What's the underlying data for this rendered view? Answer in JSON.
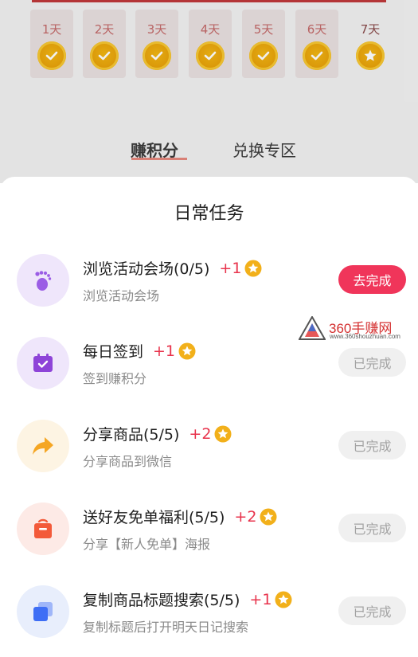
{
  "checkin": {
    "days": [
      {
        "label": "1天",
        "state": "checked"
      },
      {
        "label": "2天",
        "state": "checked"
      },
      {
        "label": "3天",
        "state": "checked"
      },
      {
        "label": "4天",
        "state": "checked"
      },
      {
        "label": "5天",
        "state": "checked"
      },
      {
        "label": "6天",
        "state": "checked"
      },
      {
        "label": "7天",
        "state": "star"
      }
    ]
  },
  "tabs": {
    "earn": "赚积分",
    "exchange": "兑换专区"
  },
  "sheet": {
    "title": "日常任务",
    "tasks": [
      {
        "title": "浏览活动会场(0/5)",
        "plus": "+1",
        "subtitle": "浏览活动会场",
        "button": "去完成",
        "icon": "footprint-icon",
        "icon_bg": "#efe6fb",
        "icon_color": "#9b5de5"
      },
      {
        "title": "每日签到",
        "plus": "+1",
        "subtitle": "签到赚积分",
        "button": "已完成",
        "icon": "calendar-icon",
        "icon_bg": "#efe6fb",
        "icon_color": "#8e44d8"
      },
      {
        "title": "分享商品(5/5)",
        "plus": "+2",
        "subtitle": "分享商品到微信",
        "button": "已完成",
        "icon": "share-arrow-icon",
        "icon_bg": "#fdf4e3",
        "icon_color": "#f5a623"
      },
      {
        "title": "送好友免单福利(5/5)",
        "plus": "+2",
        "subtitle": "分享【新人免单】海报",
        "button": "已完成",
        "icon": "gift-bag-icon",
        "icon_bg": "#fdeae6",
        "icon_color": "#f35a3a"
      },
      {
        "title": "复制商品标题搜索(5/5)",
        "plus": "+1",
        "subtitle": "复制标题后打开明天日记搜索",
        "button": "已完成",
        "icon": "copy-icon",
        "icon_bg": "#e8eefc",
        "icon_color": "#3e6ef5"
      }
    ]
  },
  "watermark": {
    "text": "360手赚网",
    "url": "www.360shouzhuan.com"
  },
  "colors": {
    "accent": "#f0355a",
    "plus": "#e8334c",
    "coin": "#e8a10a"
  }
}
